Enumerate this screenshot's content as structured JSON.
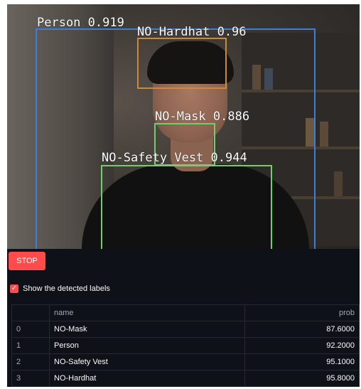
{
  "detections": [
    {
      "label": "Person 0.919",
      "color": "#3d7fd6"
    },
    {
      "label": "NO-Hardhat 0.96",
      "color": "#c98a3c"
    },
    {
      "label": "NO-Mask 0.886",
      "color": "#6fcf6a"
    },
    {
      "label": "NO-Safety Vest 0.944",
      "color": "#6fcf6a"
    }
  ],
  "controls": {
    "stop_label": "STOP",
    "show_labels_text": "Show the detected labels",
    "show_labels_checked": true
  },
  "table": {
    "headers": {
      "index": "",
      "name": "name",
      "prob": "prob"
    },
    "rows": [
      {
        "index": "0",
        "name": "NO-Mask",
        "prob": "87.6000"
      },
      {
        "index": "1",
        "name": "Person",
        "prob": "92.2000"
      },
      {
        "index": "2",
        "name": "NO-Safety Vest",
        "prob": "95.1000"
      },
      {
        "index": "3",
        "name": "NO-Hardhat",
        "prob": "95.8000"
      }
    ]
  },
  "colors": {
    "accent": "#ff4b4b",
    "background": "#0e1117"
  }
}
